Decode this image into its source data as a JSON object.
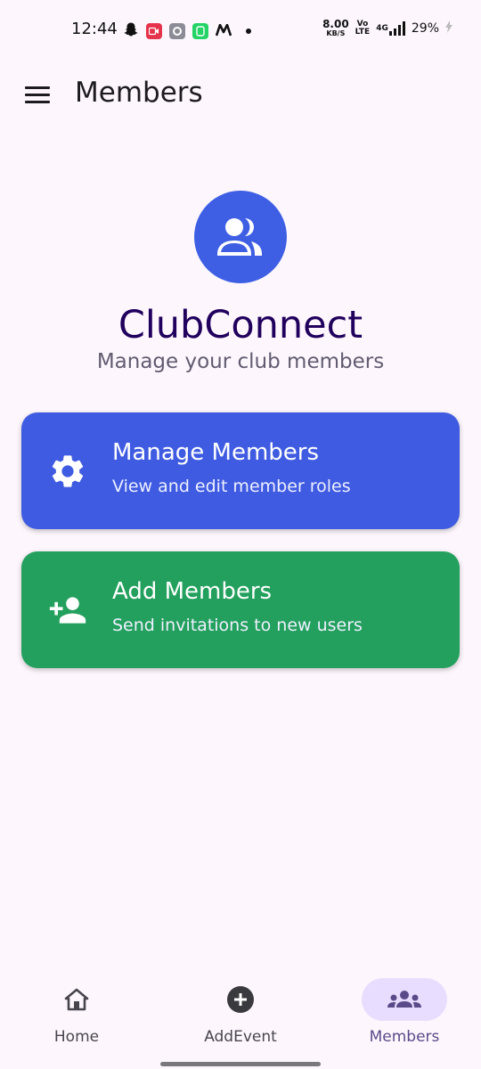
{
  "status_bar": {
    "time": "12:44",
    "net_speed_value": "8.00",
    "net_speed_unit": "KB/S",
    "volte_top": "Vo",
    "volte_bottom": "LTE",
    "network": "4G",
    "battery": "29%",
    "app_icons": [
      "snapchat-icon",
      "video-app-icon",
      "settings-app-icon",
      "whatsapp-business-icon",
      "m-app-icon"
    ],
    "colors": {
      "video_app": "#e5334b",
      "settings_app": "#8c8c96",
      "whatsapp_app": "#25d366"
    }
  },
  "appbar": {
    "title": "Members",
    "menu_icon": "menu-icon"
  },
  "hero": {
    "icon": "group-icon",
    "title": "ClubConnect",
    "subtitle": "Manage your club members",
    "colors": {
      "avatar_bg": "#3e5fe4",
      "title": "#21005d"
    }
  },
  "cards": [
    {
      "icon": "settings-gear-icon",
      "title": "Manage Members",
      "description": "View and edit member roles",
      "color": "#3f5be1"
    },
    {
      "icon": "person-add-icon",
      "title": "Add Members",
      "description": "Send invitations to new users",
      "color": "#23a05d"
    }
  ],
  "bottom_nav": {
    "items": [
      {
        "label": "Home",
        "icon": "home-icon",
        "active": false
      },
      {
        "label": "AddEvent",
        "icon": "add-circle-icon",
        "active": false
      },
      {
        "label": "Members",
        "icon": "groups-icon",
        "active": true
      }
    ],
    "colors": {
      "active_indicator": "#e9ddff",
      "active_label": "#5b4a8a"
    }
  }
}
